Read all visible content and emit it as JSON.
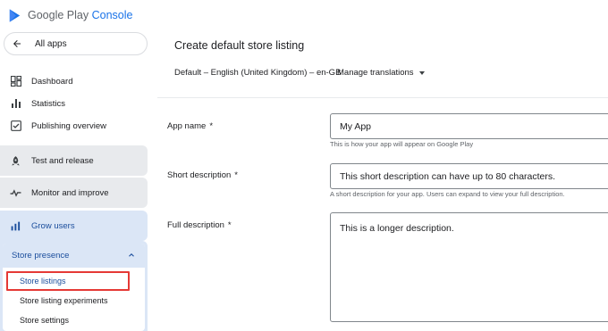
{
  "app": {
    "brand_main": "Google Play",
    "brand_sub": "Console"
  },
  "nav": {
    "all_apps": "All apps",
    "items": [
      {
        "label": "Dashboard",
        "icon": "dashboard-icon"
      },
      {
        "label": "Statistics",
        "icon": "bar-chart-icon"
      },
      {
        "label": "Publishing overview",
        "icon": "publishing-icon"
      }
    ],
    "groups": [
      {
        "label": "Test and release",
        "icon": "rocket-icon"
      },
      {
        "label": "Monitor and improve",
        "icon": "monitor-icon"
      },
      {
        "label": "Grow users",
        "icon": "grow-icon"
      }
    ],
    "store_presence": {
      "label": "Store presence",
      "items": [
        "Store listings",
        "Store listing experiments",
        "Store settings"
      ]
    }
  },
  "main": {
    "title": "Create default store listing",
    "language": "Default – English (United Kingdom) – en-GB",
    "manage_translations": "Manage translations",
    "fields": [
      {
        "label": "App name",
        "required": "*",
        "value": "My App",
        "hint": "This is how your app will appear on Google Play"
      },
      {
        "label": "Short description",
        "required": "*",
        "value": "This short description can have up to 80 characters.",
        "hint": "A short description for your app. Users can expand to view your full description."
      },
      {
        "label": "Full description",
        "required": "*",
        "value": "This is a longer description."
      }
    ]
  },
  "colors": {
    "accent": "#1a73e8",
    "highlight": "#e53935",
    "active_nav_bg": "#dbe6f6",
    "nav_group_bg": "#e8eaed"
  }
}
